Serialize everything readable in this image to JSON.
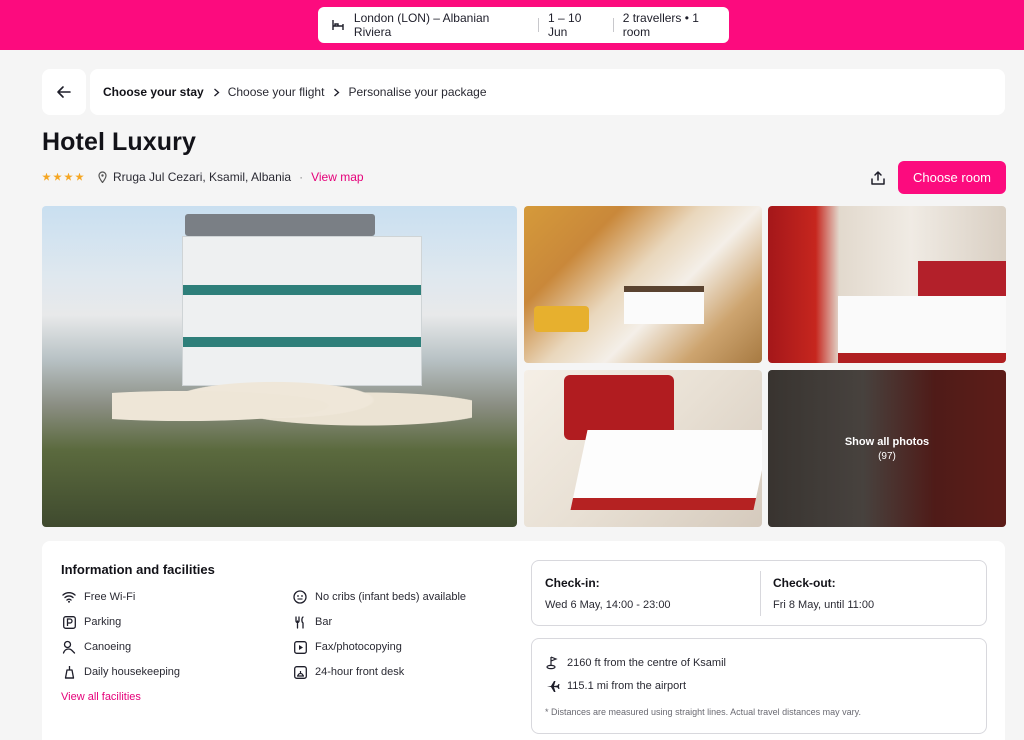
{
  "colors": {
    "brand": "#fc0b7e",
    "link": "#e5007a",
    "star": "#f5a623"
  },
  "search": {
    "route": "London (LON) – Albanian Riviera",
    "dates": "1 – 10 Jun",
    "travellers": "2 travellers • 1 room"
  },
  "breadcrumb": {
    "steps": [
      "Choose your stay",
      "Choose your flight",
      "Personalise your package"
    ]
  },
  "hotel": {
    "name": "Hotel Luxury",
    "star_rating": 4,
    "address": "Rruga Jul Cezari, Ksamil, Albania",
    "view_map": "View map",
    "choose_room": "Choose room"
  },
  "gallery": {
    "show_all": "Show all photos",
    "count": "(97)"
  },
  "info": {
    "title": "Information and facilities",
    "facilities": [
      {
        "icon": "wifi-icon",
        "label": "Free Wi-Fi"
      },
      {
        "icon": "no-crib-icon",
        "label": "No cribs (infant beds) available"
      },
      {
        "icon": "parking-icon",
        "label": "Parking"
      },
      {
        "icon": "bar-icon",
        "label": "Bar"
      },
      {
        "icon": "canoe-icon",
        "label": "Canoeing"
      },
      {
        "icon": "fax-icon",
        "label": "Fax/photocopying"
      },
      {
        "icon": "housekeeping-icon",
        "label": "Daily housekeeping"
      },
      {
        "icon": "front-desk-icon",
        "label": "24-hour front desk"
      }
    ],
    "view_all": "View all facilities"
  },
  "checkin": {
    "label": "Check-in:",
    "value": "Wed 6 May, 14:00 - 23:00"
  },
  "checkout": {
    "label": "Check-out:",
    "value": "Fri 8 May, until 11:00"
  },
  "distances": {
    "centre": "2160 ft from the centre of Ksamil",
    "airport": "115.1 mi from the airport",
    "note": "* Distances are measured using straight lines. Actual travel distances may vary."
  }
}
